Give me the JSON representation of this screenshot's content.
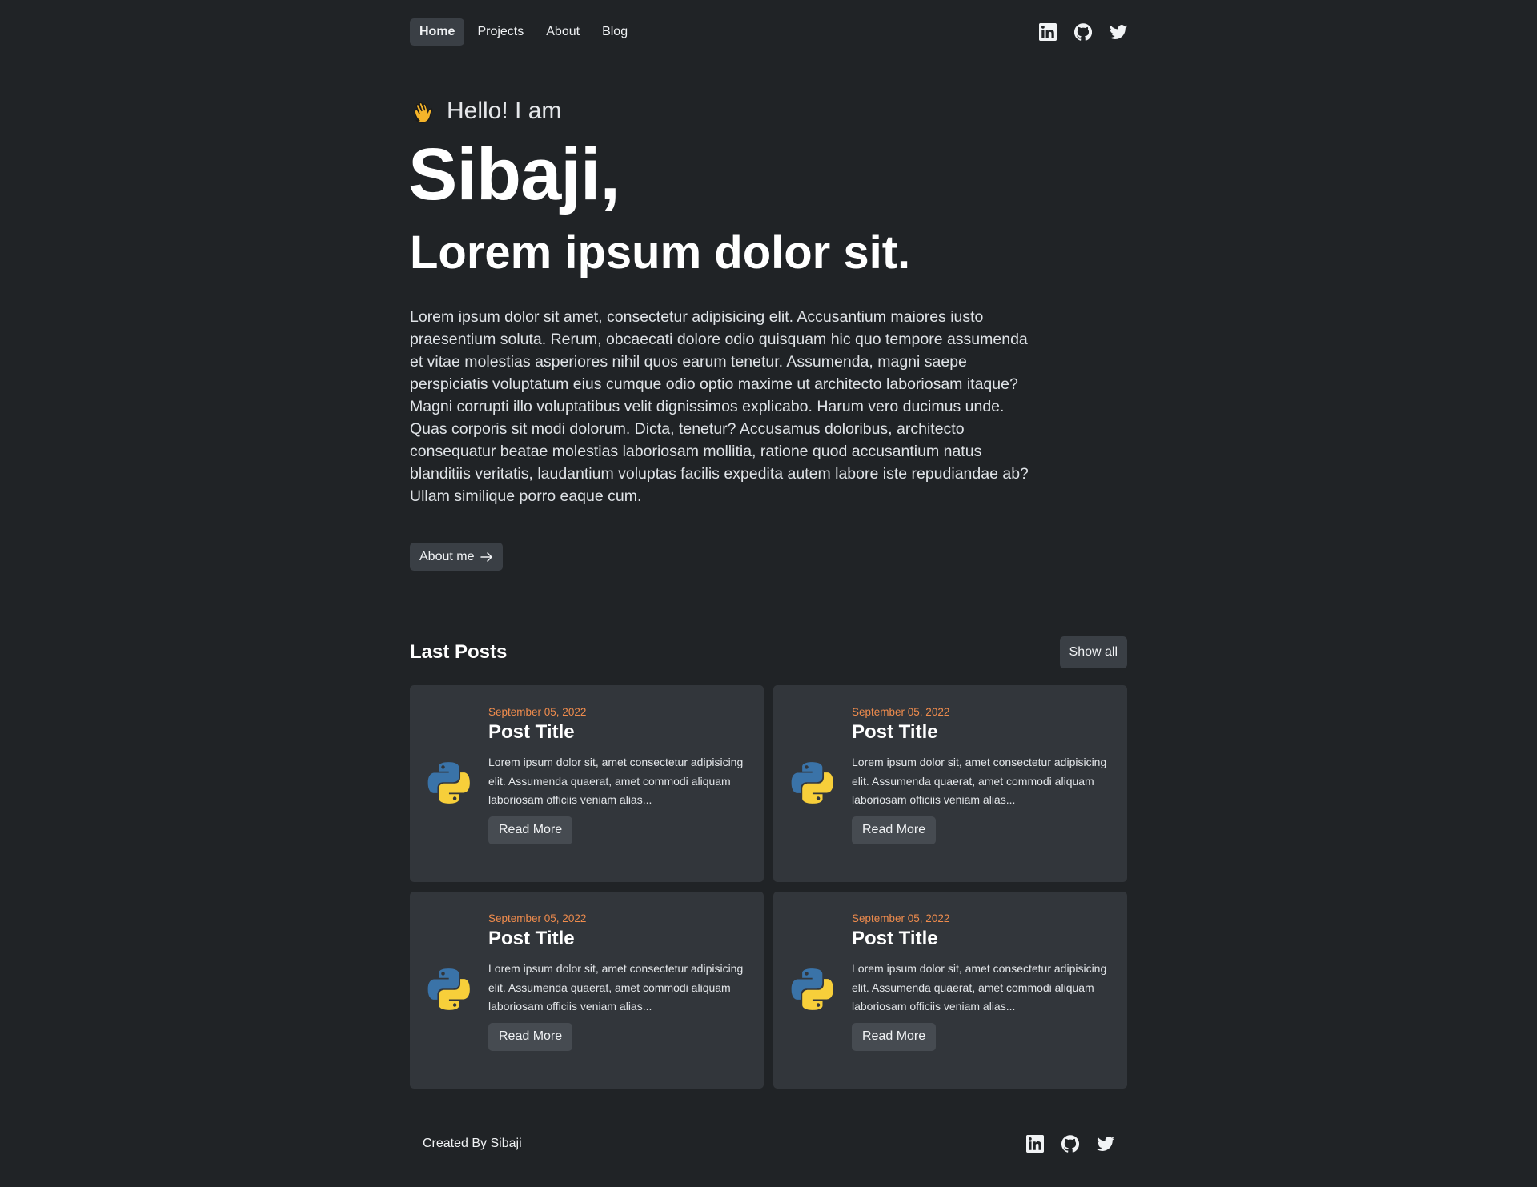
{
  "nav": {
    "links": [
      {
        "label": "Home",
        "active": true
      },
      {
        "label": "Projects",
        "active": false
      },
      {
        "label": "About",
        "active": false
      },
      {
        "label": "Blog",
        "active": false
      }
    ],
    "social": [
      "linkedin-icon",
      "github-icon",
      "twitter-icon"
    ]
  },
  "hero": {
    "greeting": "Hello! I am",
    "greeting_icon": "waving-hand-icon",
    "name": "Sibaji,",
    "tagline": "Lorem ipsum dolor sit.",
    "intro": "Lorem ipsum dolor sit amet, consectetur adipisicing elit. Accusantium maiores iusto praesentium soluta. Rerum, obcaecati dolore odio quisquam hic quo tempore assumenda et vitae molestias asperiores nihil quos earum tenetur. Assumenda, magni saepe perspiciatis voluptatum eius cumque odio optio maxime ut architecto laboriosam itaque? Magni corrupti illo voluptatibus velit dignissimos explicabo. Harum vero ducimus unde. Quas corporis sit modi dolorum. Dicta, tenetur? Accusamus doloribus, architecto consequatur beatae molestias laboriosam mollitia, ratione quod accusantium natus blanditiis veritatis, laudantium voluptas facilis expedita autem labore iste repudiandae ab? Ullam similique porro eaque cum.",
    "about_button": "About me",
    "about_button_icon": "arrow-right-icon"
  },
  "posts": {
    "title": "Last Posts",
    "show_all": "Show all",
    "items": [
      {
        "date": "September 05, 2022",
        "title": "Post Title",
        "excerpt": "Lorem ipsum dolor sit, amet consectetur adipisicing elit. Assumenda quaerat, amet commodi aliquam laboriosam officiis veniam alias...",
        "button": "Read More",
        "icon": "python-logo-icon"
      },
      {
        "date": "September 05, 2022",
        "title": "Post Title",
        "excerpt": "Lorem ipsum dolor sit, amet consectetur adipisicing elit. Assumenda quaerat, amet commodi aliquam laboriosam officiis veniam alias...",
        "button": "Read More",
        "icon": "python-logo-icon"
      },
      {
        "date": "September 05, 2022",
        "title": "Post Title",
        "excerpt": "Lorem ipsum dolor sit, amet consectetur adipisicing elit. Assumenda quaerat, amet commodi aliquam laboriosam officiis veniam alias...",
        "button": "Read More",
        "icon": "python-logo-icon"
      },
      {
        "date": "September 05, 2022",
        "title": "Post Title",
        "excerpt": "Lorem ipsum dolor sit, amet consectetur adipisicing elit. Assumenda quaerat, amet commodi aliquam laboriosam officiis veniam alias...",
        "button": "Read More",
        "icon": "python-logo-icon"
      }
    ]
  },
  "footer": {
    "credit": "Created By Sibaji",
    "social": [
      "linkedin-icon",
      "github-icon",
      "twitter-icon"
    ]
  },
  "colors": {
    "background": "#202326",
    "card": "#32363b",
    "button": "#3a3f45",
    "date_accent": "#f08c4d",
    "text": "#ffffff"
  }
}
